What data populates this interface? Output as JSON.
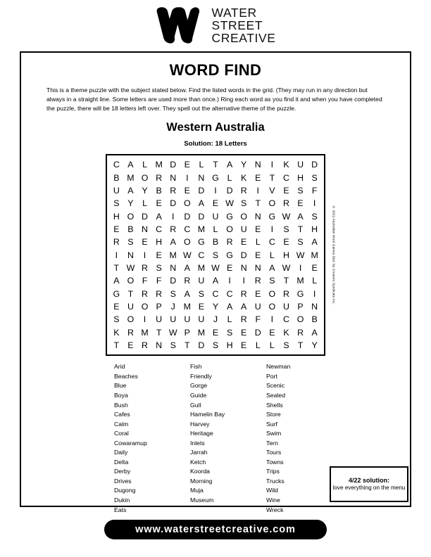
{
  "brand": {
    "logo_icon": "water-street-creative-w-logo",
    "line1": "WATER",
    "line2": "STREET",
    "line3": "CREATIVE"
  },
  "puzzle": {
    "title": "WORD FIND",
    "instructions": "This is a theme puzzle with the subject stated below. Find the listed words in the grid. (They may run in any direction but always in a straight line. Some letters are used more than once.) Ring each word as you find it and when you have completed the puzzle, there will be 18 letters left over. They spell out the alternative theme of the puzzle.",
    "subject": "Western Australia",
    "solution_hint": "Solution: 18 Letters",
    "copyright": "© 2021 Australian Word Games Dist. by Creators Syndicate Inc.",
    "grid": [
      [
        "C",
        "A",
        "L",
        "M",
        "D",
        "E",
        "L",
        "T",
        "A",
        "Y",
        "N",
        "I",
        "K",
        "U",
        "D"
      ],
      [
        "B",
        "M",
        "O",
        "R",
        "N",
        "I",
        "N",
        "G",
        "L",
        "K",
        "E",
        "T",
        "C",
        "H",
        "S"
      ],
      [
        "U",
        "A",
        "Y",
        "B",
        "R",
        "E",
        "D",
        "I",
        "D",
        "R",
        "I",
        "V",
        "E",
        "S",
        "F"
      ],
      [
        "S",
        "Y",
        "L",
        "E",
        "D",
        "O",
        "A",
        "E",
        "W",
        "S",
        "T",
        "O",
        "R",
        "E",
        "I"
      ],
      [
        "H",
        "O",
        "D",
        "A",
        "I",
        "D",
        "D",
        "U",
        "G",
        "O",
        "N",
        "G",
        "W",
        "A",
        "S"
      ],
      [
        "E",
        "B",
        "N",
        "C",
        "R",
        "C",
        "M",
        "L",
        "O",
        "U",
        "E",
        "I",
        "S",
        "T",
        "H"
      ],
      [
        "R",
        "S",
        "E",
        "H",
        "A",
        "O",
        "G",
        "B",
        "R",
        "E",
        "L",
        "C",
        "E",
        "S",
        "A"
      ],
      [
        "I",
        "N",
        "I",
        "E",
        "M",
        "W",
        "C",
        "S",
        "G",
        "D",
        "E",
        "L",
        "H",
        "W",
        "M"
      ],
      [
        "T",
        "W",
        "R",
        "S",
        "N",
        "A",
        "M",
        "W",
        "E",
        "N",
        "N",
        "A",
        "W",
        "I",
        "E"
      ],
      [
        "A",
        "O",
        "F",
        "F",
        "D",
        "R",
        "U",
        "A",
        "I",
        "I",
        "R",
        "S",
        "T",
        "M",
        "L"
      ],
      [
        "G",
        "T",
        "R",
        "R",
        "S",
        "A",
        "S",
        "C",
        "C",
        "R",
        "E",
        "O",
        "R",
        "G",
        "I"
      ],
      [
        "E",
        "U",
        "O",
        "P",
        "J",
        "M",
        "E",
        "Y",
        "A",
        "A",
        "U",
        "O",
        "U",
        "P",
        "N"
      ],
      [
        "S",
        "O",
        "I",
        "U",
        "U",
        "U",
        "U",
        "J",
        "L",
        "R",
        "F",
        "I",
        "C",
        "O",
        "B"
      ],
      [
        "K",
        "R",
        "M",
        "T",
        "W",
        "P",
        "M",
        "E",
        "S",
        "E",
        "D",
        "E",
        "K",
        "R",
        "A"
      ],
      [
        "T",
        "E",
        "R",
        "N",
        "S",
        "T",
        "D",
        "S",
        "H",
        "E",
        "L",
        "L",
        "S",
        "T",
        "Y"
      ]
    ],
    "word_columns": [
      [
        "Arid",
        "Beaches",
        "Blue",
        "Boya",
        "Bush",
        "Cafes",
        "Calm",
        "Coral",
        "Cowaramup",
        "Daily",
        "Delta",
        "Derby",
        "Drives",
        "Dugong",
        "Dukin",
        "Eats"
      ],
      [
        "Fish",
        "Friendly",
        "Gorge",
        "Guide",
        "Gull",
        "Hamelin Bay",
        "Harvey",
        "Heritage",
        "Inlets",
        "Jarrah",
        "Ketch",
        "Koorda",
        "Morning",
        "Muja",
        "Museum"
      ],
      [
        "Newman",
        "Port",
        "Scenic",
        "Sealed",
        "Shells",
        "Store",
        "Surf",
        "Swim",
        "Tern",
        "Tours",
        "Towns",
        "Trips",
        "Trucks",
        "Wild",
        "Wine",
        "Wreck"
      ]
    ]
  },
  "previous_solution": {
    "title": "4/22 solution:",
    "text": "love everything on the menu"
  },
  "footer": {
    "url": "www.waterstreetcreative.com"
  }
}
